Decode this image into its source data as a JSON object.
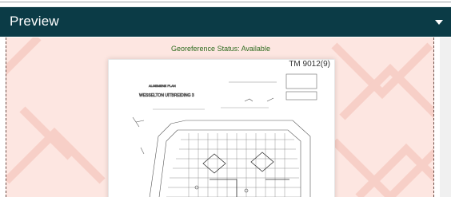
{
  "header": {
    "title": "Preview",
    "toggle_icon": "chevron-down-icon"
  },
  "preview": {
    "georeference_status": "Georeference Status: Available",
    "map_reference": "TM 9012(9)",
    "map_title": "WESSELTON UITBREIDING 3",
    "map_subtitle": "ALGEMENE PLAN"
  },
  "colors": {
    "header_bg": "#0b3b46",
    "panel_bg": "#fde6e1",
    "status_text": "#2e6b1e"
  }
}
